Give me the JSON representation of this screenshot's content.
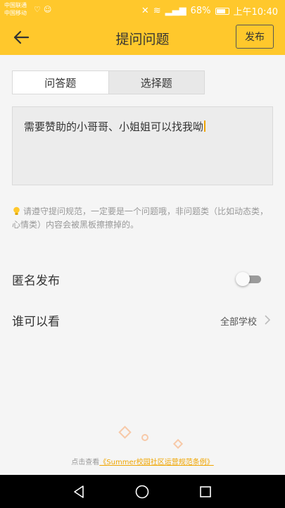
{
  "status_bar": {
    "carrier_1": "中国联通",
    "carrier_2": "中国移动",
    "battery": "68%",
    "time": "上午10:40"
  },
  "header": {
    "title": "提问问题",
    "publish_label": "发布"
  },
  "tabs": [
    {
      "label": "问答题",
      "active": true
    },
    {
      "label": "选择题",
      "active": false
    }
  ],
  "question_input": {
    "value": "需要赞助的小哥哥、小姐姐可以找我呦"
  },
  "notice": {
    "text": "请遵守提问规范，一定要是一个问题哦，非问题类（比如动态类，心情类）内容会被黑板擦擦掉的。"
  },
  "settings": {
    "anonymous_label": "匿名发布",
    "anonymous_on": false,
    "visibility_label": "谁可以看",
    "visibility_value": "全部学校"
  },
  "footer": {
    "prefix": "点击查看",
    "link_text": "《Summer校园社区运营规范条例》"
  },
  "colors": {
    "brand": "#ffc82c",
    "accent": "#f0a500"
  },
  "icons": [
    "back-arrow-icon",
    "lightbulb-icon",
    "chevron-right-icon",
    "nav-back-icon",
    "nav-home-icon",
    "nav-recents-icon"
  ]
}
